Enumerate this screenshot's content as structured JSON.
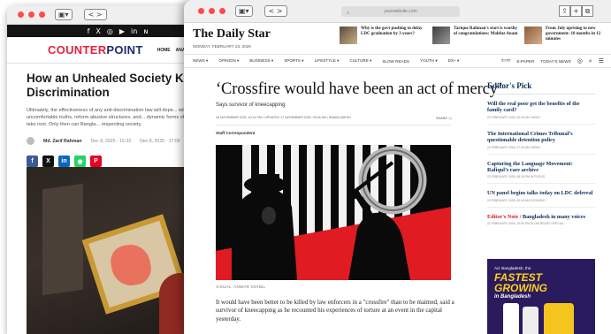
{
  "back_window": {
    "nav_back_label": "< >",
    "tab_icon_label": "▣▾",
    "social": [
      "f",
      "X",
      "◎",
      "▶",
      "in",
      "ɴ"
    ],
    "logo_counter": "COUNTER",
    "logo_point": "POINT",
    "menu": [
      "HOME",
      "ANALYSIS ▾",
      "LO"
    ],
    "title": "How an Unhealed Society Keeps R... Discrimination",
    "title_line1": "How an Unhealed Society Keeps R",
    "title_line2": "Discrimination",
    "lead": "Ultimately, the effectiveness of any anti-discrimination law will depe... will to confront uncomfortable truths, reform abusive structures, and... dynamic forms of discrimination can take root. Only then can Bangla... respecting society.",
    "author": "Md. Zarif Rahman",
    "date1": "Dec 8, 2025 - 15:33",
    "date2": "Dec 8, 2025 - 17:00",
    "share_buttons": [
      {
        "label": "f",
        "color": "#3b5998"
      },
      {
        "label": "X",
        "color": "#111111"
      },
      {
        "label": "in",
        "color": "#0a66c2"
      },
      {
        "label": "◉",
        "color": "#25d366"
      },
      {
        "label": "P",
        "color": "#e60023"
      }
    ]
  },
  "front_window": {
    "url": "yourwebsite.com",
    "nav_back_label": "< >",
    "tab_icon_label": "▣▾",
    "controls": [
      "⇪",
      "+",
      "⧉"
    ],
    "logo": "The Daily Star",
    "date": "MONDAY, FEBRUARY 23, 2026",
    "teasers": [
      {
        "title": "Why is the govt pushing to delay LDC graduation by 3 years?"
      },
      {
        "title": "Tarique Rahman's start is worthy of congratulations: Mahfuz Anam"
      },
      {
        "title": "From July uprising to new government: 18 months in 12 minutes"
      }
    ],
    "nav": [
      "NEWS ▾",
      "OPINION ▾",
      "BUSINESS ▾",
      "SPORTS ▾",
      "LIFESTYLE ▾",
      "CULTURE ▾",
      "SLOW READS",
      "YOUTH ▾",
      "DS+ ▾"
    ],
    "nav_right": [
      "বাংলা",
      "E-PAPER",
      "TODAY'S NEWS"
    ],
    "article": {
      "title": "‘Crossfire would have been an act of mercy’",
      "subtitle": "Says survivor of kneecapping",
      "meta": "16 NOVEMBER 2025, 10:14 PM ▪ UPDATED 17 NOVEMBER 2025, 03:04 AM ▪ BANGLADESH",
      "share": "SHARE ◁",
      "author": "Staff Correspondent",
      "caption": "VISUAL: ANWAR SOHEL",
      "body": "It would have been better to be killed by law enforcers in a \"crossfire\" than to be maimed, said a survivor of kneecapping as he recounted his experiences of torture at an event in the capital yesterday."
    },
    "editors_pick": {
      "heading": "Editor's Pick",
      "items": [
        {
          "title": "Will the real poor get the benefits of the family card?",
          "meta": "23 FEBRUARY 2026, 00:43 AM   VIEWS"
        },
        {
          "title": "The International Crimes Tribunal’s questionable detention policy",
          "meta": "22 FEBRUARY 2026, 07:45 AM   VIEWS"
        },
        {
          "title": "Capturing the Language Movement: Rafiqul’s rare archive",
          "meta": "22 FEBRUARY 2026, 08:18 PM   IN FOCUS"
        },
        {
          "title": "UN panel begins talks today on LDC deferral",
          "meta": "23 FEBRUARY 2026, 00:00 AM   ECONOMY"
        },
        {
          "prefix": "Editor's Note /",
          "title": " Bangladesh in many voices",
          "meta": "22 FEBRUARY 2026, 10:50 PM   SLOW READS SPECIAL"
        }
      ]
    },
    "ad": {
      "line1": "Ad. Bangladesh, the",
      "line2": "FASTEST",
      "line3": "GROWING",
      "line4": "in Bangladesh"
    }
  }
}
